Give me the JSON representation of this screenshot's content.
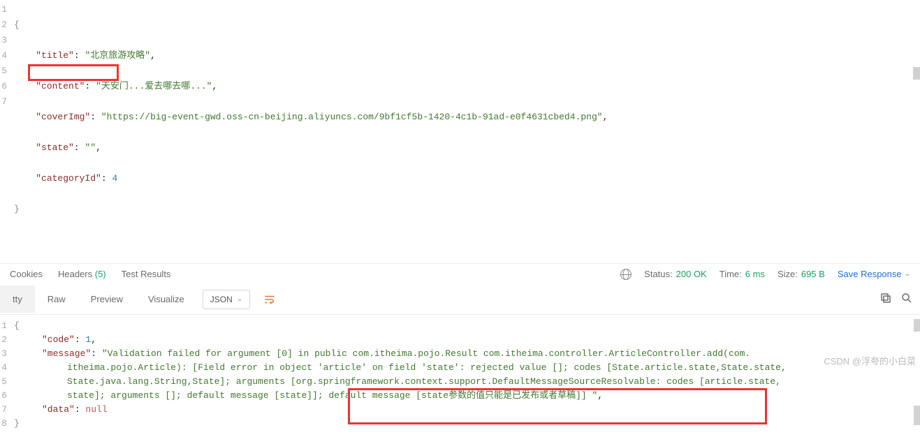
{
  "request": {
    "lines": [
      "1",
      "2",
      "3",
      "4",
      "5",
      "6",
      "7"
    ],
    "json": {
      "title": "北京旅游攻略",
      "content": "天安门...爱去哪去哪...",
      "coverImg": "https://big-event-gwd.oss-cn-beijing.aliyuncs.com/9bf1cf5b-1420-4c1b-91ad-e0f4631cbed4.png",
      "state": "",
      "categoryId": 4
    }
  },
  "tabs_mid": {
    "cookies": "Cookies",
    "headers": "Headers",
    "headers_count": "(5)",
    "testresults": "Test Results"
  },
  "status": {
    "label": "Status:",
    "code": "200 OK",
    "time_label": "Time:",
    "time_val": "6 ms",
    "size_label": "Size:",
    "size_val": "695 B",
    "save": "Save Response"
  },
  "viewtabs": {
    "pretty": "tty",
    "raw": "Raw",
    "preview": "Preview",
    "visualize": "Visualize",
    "format": "JSON"
  },
  "response": {
    "lines": [
      "1",
      "2",
      "3",
      "4",
      "5",
      "6",
      "7",
      "8"
    ],
    "code_key": "\"code\"",
    "code_val": "1",
    "message_key": "\"message\"",
    "message_val_1": "\"Validation failed for argument [0] in public com.itheima.pojo.Result com.itheima.controller.ArticleController.add(com.",
    "message_val_2": "itheima.pojo.Article): [Field error in object 'article' on field 'state': rejected value []; codes [State.article.state,State.state,",
    "message_val_3": "State.java.lang.String,State]; arguments [org.springframework.context.support.DefaultMessageSourceResolvable: codes [article.state,",
    "message_val_4": "state]; arguments []; default message [state]]; default message [state参数的值只能是已发布或者草稿]] \"",
    "data_key": "\"data\"",
    "data_val": "null"
  },
  "watermark": "CSDN @浮夸的小白菜"
}
